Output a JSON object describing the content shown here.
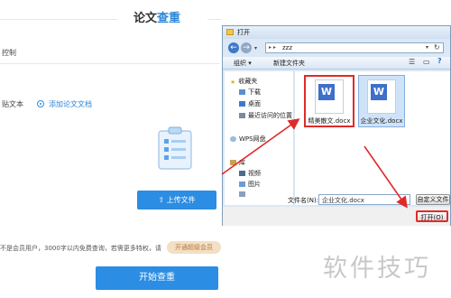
{
  "page": {
    "title_prefix": "论文",
    "title_highlight": "查重",
    "field_label": "控制",
    "paste_label": "贴文本",
    "upload_label": "添加论文文档",
    "upload_button": "上传文件",
    "notice": "不是会员用户，3000字以内免费查询，若需更多特权，请",
    "vip_button": "开通超级会员",
    "start_button": "开始查重"
  },
  "dialog": {
    "title": "打开",
    "path": "zzz",
    "toolbar": {
      "organize": "组织 ▾",
      "new_folder": "新建文件夹"
    },
    "nav_items": [
      {
        "label": "收藏夹",
        "icon": "star-icon"
      },
      {
        "label": "下载",
        "icon": "download-folder-icon"
      },
      {
        "label": "桌面",
        "icon": "desktop-icon"
      },
      {
        "label": "最近访问的位置",
        "icon": "recent-places-icon"
      },
      {
        "label": "WPS网盘",
        "icon": "cloud-icon"
      },
      {
        "label": "库",
        "icon": "library-icon"
      },
      {
        "label": "视频",
        "icon": "video-icon"
      },
      {
        "label": "图片",
        "icon": "image-icon"
      }
    ],
    "files": [
      {
        "name": "精美散文.docx"
      },
      {
        "name": "企业文化.docx"
      }
    ],
    "filename_label": "文件名(N):",
    "filename_value": "企业文化.docx",
    "filter_value": "自定义文件",
    "open_button": "打开(O)"
  },
  "watermark": "软件技巧",
  "colors": {
    "accent": "#2b8de3",
    "highlight": "#e02a2a"
  }
}
